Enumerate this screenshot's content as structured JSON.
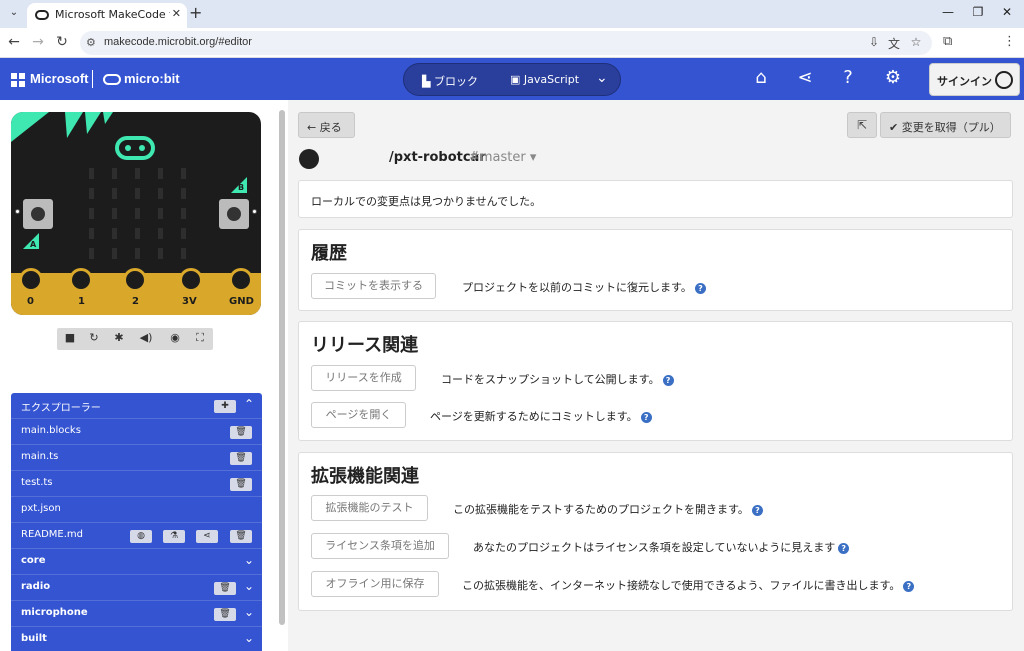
{
  "browser": {
    "tab_title": "Microsoft MakeCode for micro:bit",
    "url": "makecode.microbit.org/#editor"
  },
  "header": {
    "ms_label": "Microsoft",
    "mb_label": "micro:bit",
    "blocks_label": "ブロック",
    "js_label": "JavaScript",
    "signin_label": "サインイン"
  },
  "simulator": {
    "pins": [
      "0",
      "1",
      "2",
      "3V",
      "GND"
    ],
    "button_a": "A",
    "button_b": "B"
  },
  "explorer": {
    "title": "エクスプローラー",
    "files": [
      "main.blocks",
      "main.ts",
      "test.ts",
      "pxt.json",
      "README.md"
    ],
    "packages": [
      "core",
      "radio",
      "microphone",
      "built"
    ]
  },
  "main": {
    "back_label": "戻る",
    "pull_label": "変更を取得（プル）",
    "repo_name": "/pxt-robotcar",
    "branch": "#master",
    "no_changes": "ローカルでの変更点は見つかりませんでした。",
    "history": {
      "title": "履歴",
      "button": "コミットを表示する",
      "desc": "プロジェクトを以前のコミットに復元します。"
    },
    "release": {
      "title": "リリース関連",
      "create_button": "リリースを作成",
      "create_desc": "コードをスナップショットして公開します。",
      "page_button": "ページを開く",
      "page_desc": "ページを更新するためにコミットします。"
    },
    "extension": {
      "title": "拡張機能関連",
      "test_button": "拡張機能のテスト",
      "test_desc": "この拡張機能をテストするためのプロジェクトを開きます。",
      "license_button": "ライセンス条項を追加",
      "license_desc": "あなたのプロジェクトはライセンス条項を設定していないように見えます",
      "offline_button": "オフライン用に保存",
      "offline_desc": "この拡張機能を、インターネット接続なしで使用できるよう、ファイルに書き出します。"
    }
  },
  "colors": {
    "brand_blue": "#3454d1",
    "gold": "#d9a82b",
    "help_blue": "#3a6fc4"
  }
}
